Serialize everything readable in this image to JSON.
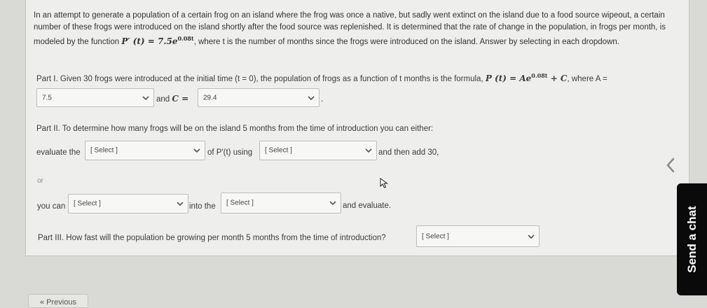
{
  "intro": "In an attempt to generate a population of a certain frog on an island where the frog was once a native, but sadly went extinct on the island due to a food source wipeout, a certain number of these frogs were introduced on the island shortly after the food source was replenished. It is determined that the rate of change in the population, in frogs per month, is modeled by the function",
  "intro_func": "P′ (t) = 7.5e",
  "intro_func_exp": "0.08t",
  "intro_tail": ", where t is the number of months since the frogs were introduced on the island. Answer by selecting in each dropdown.",
  "part1": {
    "text": "Part I. Given 30 frogs were introduced at the initial time (t = 0), the population of frogs as a function of t months is the formula,",
    "formula": "P (t) = Ae",
    "formula_exp": "0.08t",
    "formula_tail": "+ C",
    "where": ", where A =",
    "a_value": "7.5",
    "and_c": "and",
    "c_symbol": "C =",
    "c_value": "29.4",
    "period": "."
  },
  "part2": {
    "text": "Part II. To determine how many frogs will be on the island 5 months from the time of introduction you can either:",
    "evaluate_the": "evaluate the",
    "select1": "[ Select ]",
    "of_pprime": "of P'(t) using",
    "select2": "[ Select ]",
    "then_add": "and then add 30,",
    "or": "or",
    "you_can": "you can",
    "select3": "[ Select ]",
    "into_the": "into the",
    "select4": "[ Select ]",
    "and_evaluate": "and evaluate."
  },
  "part3": {
    "text": "Part III. How fast will the population be growing per month 5 months from the time of introduction?",
    "select5": "[ Select ]"
  },
  "chat": {
    "label": "Send a chat"
  },
  "nav": {
    "previous_label": "« Previous"
  }
}
